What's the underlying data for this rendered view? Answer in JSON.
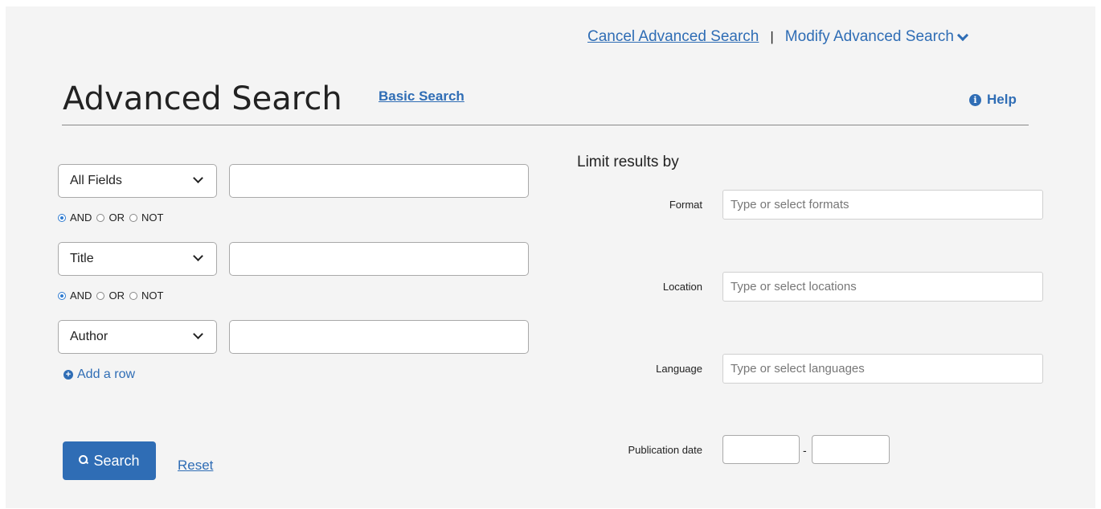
{
  "top_links": {
    "cancel": "Cancel Advanced Search",
    "separator": "|",
    "modify": "Modify Advanced Search"
  },
  "header": {
    "title": "Advanced Search",
    "basic_search": "Basic Search",
    "help": "Help"
  },
  "rows": [
    {
      "field": "All Fields",
      "value": ""
    },
    {
      "field": "Title",
      "value": ""
    },
    {
      "field": "Author",
      "value": ""
    }
  ],
  "boolean": {
    "and": "AND",
    "or": "OR",
    "not": "NOT",
    "selected": "AND"
  },
  "add_row": "Add a row",
  "search_button": "Search",
  "reset": "Reset",
  "limits": {
    "title": "Limit results by",
    "format": {
      "label": "Format",
      "placeholder": "Type or select formats"
    },
    "location": {
      "label": "Location",
      "placeholder": "Type or select locations"
    },
    "language": {
      "label": "Language",
      "placeholder": "Type or select languages"
    },
    "publication_date": {
      "label": "Publication date",
      "separator": "-",
      "from": "",
      "to": ""
    }
  },
  "colors": {
    "accent": "#2f6db5",
    "background": "#f4f4f4"
  }
}
